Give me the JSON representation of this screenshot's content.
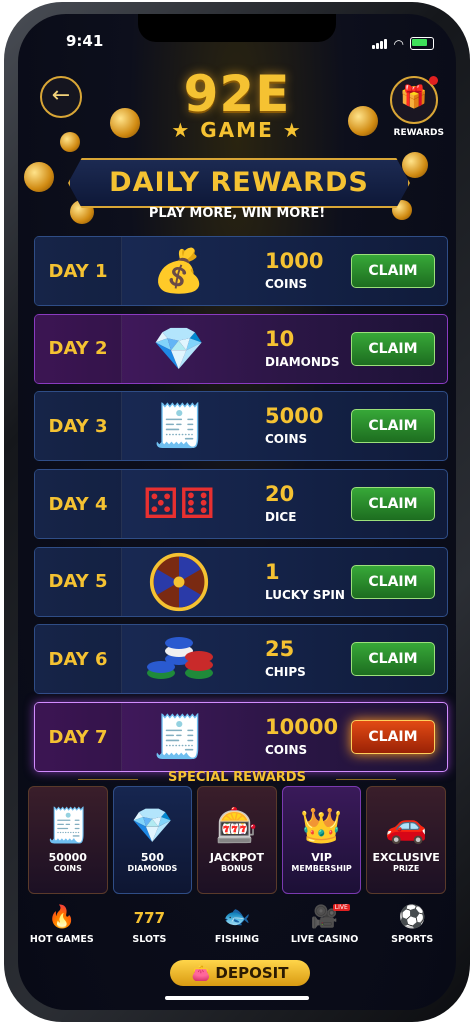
{
  "status": {
    "time": "9:41"
  },
  "header": {
    "logo_main": "92E",
    "logo_sub": "★ GAME ★",
    "rewards_label": "REWARDS"
  },
  "banner": {
    "title": "DAILY REWARDS",
    "subtitle": "PLAY MORE, WIN MORE!"
  },
  "days": [
    {
      "day": "DAY 1",
      "icon": "coin-stack-icon",
      "amount": "1000",
      "unit": "COINS",
      "claim": "CLAIM"
    },
    {
      "day": "DAY 2",
      "icon": "diamond-icon",
      "amount": "10",
      "unit": "DIAMONDS",
      "claim": "CLAIM"
    },
    {
      "day": "DAY 3",
      "icon": "treasure-chest-icon",
      "amount": "5000",
      "unit": "COINS",
      "claim": "CLAIM"
    },
    {
      "day": "DAY 4",
      "icon": "dice-icon",
      "amount": "20",
      "unit": "DICE",
      "claim": "CLAIM"
    },
    {
      "day": "DAY 5",
      "icon": "lucky-wheel-icon",
      "amount": "1",
      "unit": "LUCKY SPIN",
      "claim": "CLAIM"
    },
    {
      "day": "DAY 6",
      "icon": "chips-icon",
      "amount": "25",
      "unit": "CHIPS",
      "claim": "CLAIM"
    },
    {
      "day": "DAY 7",
      "icon": "treasure-chest-icon",
      "amount": "10000",
      "unit": "COINS",
      "claim": "CLAIM"
    }
  ],
  "special": {
    "title": "SPECIAL REWARDS",
    "tiles": [
      {
        "icon": "treasure-chest-icon",
        "line1": "50000",
        "line2": "COINS"
      },
      {
        "icon": "diamond-pile-icon",
        "line1": "500",
        "line2": "DIAMONDS"
      },
      {
        "icon": "slot-machine-icon",
        "line1": "JACKPOT",
        "line2": "BONUS"
      },
      {
        "icon": "vip-badge-icon",
        "line1": "VIP",
        "line2": "MEMBERSHIP"
      },
      {
        "icon": "sports-car-icon",
        "line1": "EXCLUSIVE",
        "line2": "PRIZE"
      }
    ]
  },
  "nav": {
    "items": [
      {
        "label": "HOT GAMES",
        "icon": "fire-icon"
      },
      {
        "label": "SLOTS",
        "icon": "slots-777-icon"
      },
      {
        "label": "FISHING",
        "icon": "fish-icon"
      },
      {
        "label": "LIVE CASINO",
        "icon": "live-camera-icon"
      },
      {
        "label": "SPORTS",
        "icon": "soccer-ball-icon"
      }
    ],
    "live_badge": "LIVE"
  },
  "deposit": {
    "label": "DEPOSIT"
  },
  "colors": {
    "gold": "#f5c232",
    "claim_green": "#37a838",
    "claim_hot": "#e24a14",
    "background": "#080a16"
  }
}
